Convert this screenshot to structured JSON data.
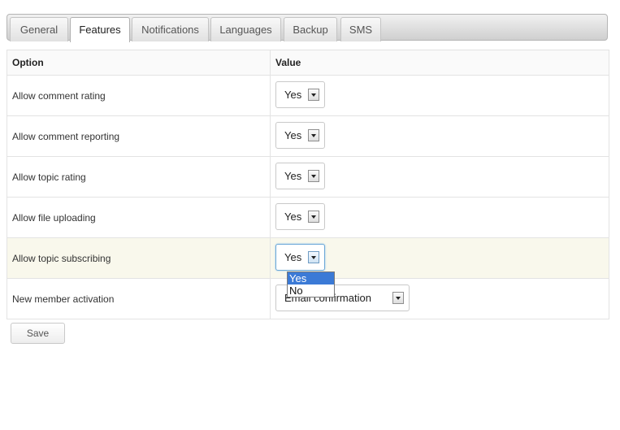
{
  "tabs": [
    {
      "label": "General",
      "active": false
    },
    {
      "label": "Features",
      "active": true
    },
    {
      "label": "Notifications",
      "active": false
    },
    {
      "label": "Languages",
      "active": false
    },
    {
      "label": "Backup",
      "active": false
    },
    {
      "label": "SMS",
      "active": false
    }
  ],
  "table": {
    "headers": [
      "Option",
      "Value"
    ],
    "rows": [
      {
        "option": "Allow comment rating",
        "value": "Yes"
      },
      {
        "option": "Allow comment reporting",
        "value": "Yes"
      },
      {
        "option": "Allow topic rating",
        "value": "Yes"
      },
      {
        "option": "Allow file uploading",
        "value": "Yes"
      },
      {
        "option": "Allow topic subscribing",
        "value": "Yes"
      },
      {
        "option": "New member activation",
        "value": "Email confirmation"
      }
    ]
  },
  "dropdown": {
    "options": [
      "Yes",
      "No"
    ],
    "selected": "Yes"
  },
  "save_label": "Save",
  "colors": {
    "highlight_row": "#f9f8ec",
    "selected_option": "#3b7ad6"
  }
}
